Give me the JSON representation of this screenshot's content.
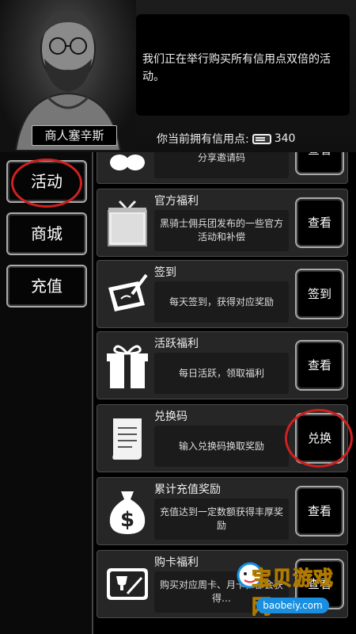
{
  "npc": {
    "name": "商人塞辛斯",
    "dialog": "我们正在举行购买所有信用点双倍的活动。"
  },
  "credits": {
    "label": "你当前拥有信用点:",
    "value": "340",
    "icon": "credit-card-icon"
  },
  "sidebar": {
    "items": [
      {
        "label": "活动",
        "selected": true
      },
      {
        "label": "商城",
        "selected": false
      },
      {
        "label": "充值",
        "selected": false
      }
    ]
  },
  "events": [
    {
      "title": "",
      "desc": "分享邀请码",
      "action": "查看",
      "icon": "eggs-icon"
    },
    {
      "title": "官方福利",
      "desc": "黑骑士佣兵团发布的一些官方活动和补偿",
      "action": "查看",
      "icon": "gift-box-icon"
    },
    {
      "title": "签到",
      "desc": "每天签到，获得对应奖励",
      "action": "签到",
      "icon": "tablet-pen-icon"
    },
    {
      "title": "活跃福利",
      "desc": "每日活跃，领取福利",
      "action": "查看",
      "icon": "present-icon"
    },
    {
      "title": "兑换码",
      "desc": "输入兑换码换取奖励",
      "action": "兑换",
      "icon": "scroll-icon"
    },
    {
      "title": "累计充值奖励",
      "desc": "充值达到一定数额获得丰厚奖励",
      "action": "查看",
      "icon": "money-bag-icon"
    },
    {
      "title": "购卡福利",
      "desc": "购买对应周卡、月卡，都会获得…",
      "action": "查看",
      "icon": "card-trophy-icon"
    }
  ],
  "watermark": {
    "text": "宝贝游戏网",
    "url": "baobeiy.com"
  },
  "colors": {
    "highlight_ring": "#d02020",
    "watermark_yellow": "#ffd21a",
    "watermark_blue": "#1a8fe0"
  }
}
